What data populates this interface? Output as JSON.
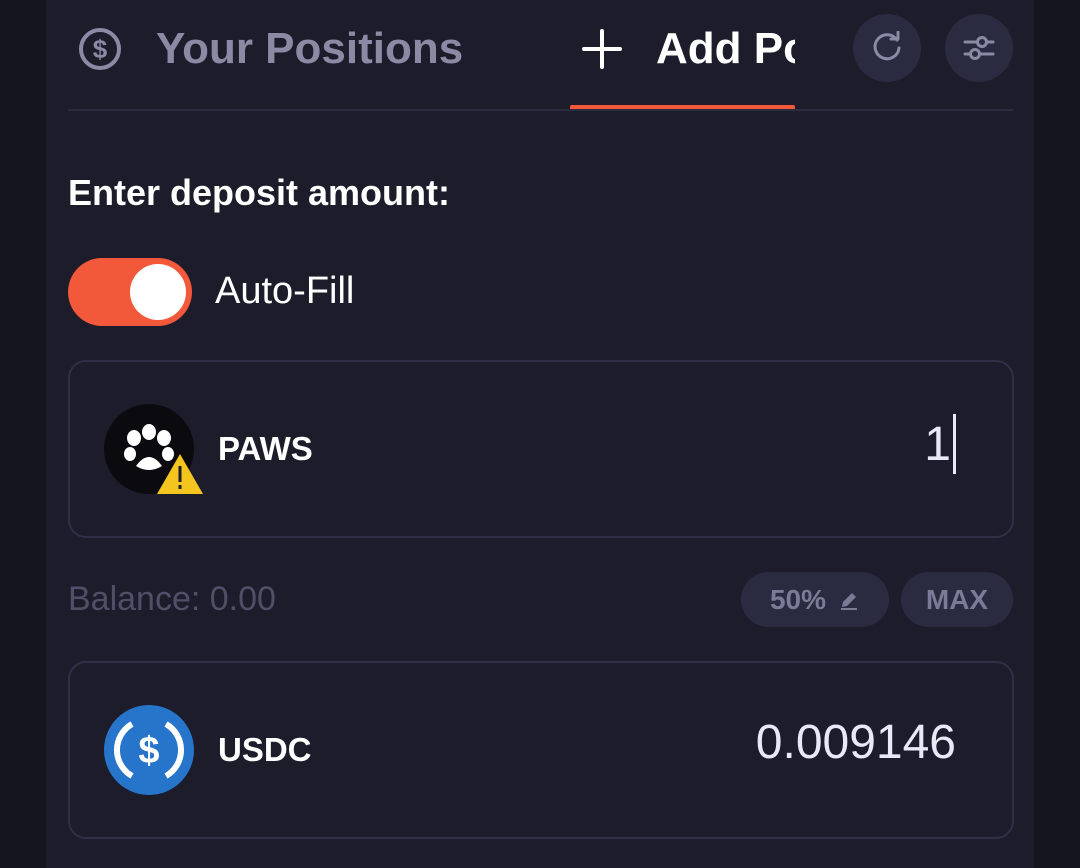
{
  "header": {
    "tabs": [
      {
        "label": "Your Positions",
        "icon": "dollar-circle-icon",
        "active": false
      },
      {
        "label": "Add Position",
        "icon": "plus-icon",
        "active": true
      }
    ],
    "actions": [
      {
        "icon": "refresh-icon"
      },
      {
        "icon": "sliders-icon"
      }
    ],
    "accent_color": "#f2583a"
  },
  "deposit": {
    "heading": "Enter deposit amount:",
    "autofill": {
      "label": "Auto-Fill",
      "enabled": true
    }
  },
  "tokens": [
    {
      "symbol": "PAWS",
      "amount": "1",
      "icon": "paws-logo-icon",
      "warning": true
    },
    {
      "symbol": "USDC",
      "amount": "0.009146",
      "icon": "usdc-logo-icon",
      "warning": false
    }
  ],
  "balance": {
    "label": "Balance: 0.00",
    "percent_button": "50%",
    "max_button": "MAX"
  }
}
